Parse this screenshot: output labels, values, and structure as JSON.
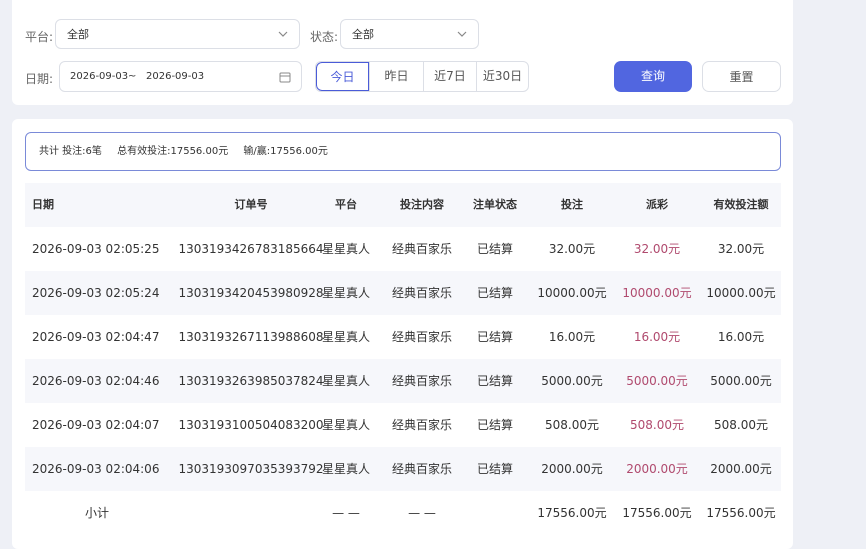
{
  "filters": {
    "platform_label": "平台:",
    "platform_value": "全部",
    "status_label": "状态:",
    "status_value": "全部",
    "date_label": "日期:",
    "date_start": "2026-09-03",
    "date_sep": "~",
    "date_end": "2026-09-03",
    "quick_ranges": [
      "今日",
      "昨日",
      "近7日",
      "近30日"
    ],
    "active_range": "今日",
    "query_label": "查询",
    "reset_label": "重置"
  },
  "summary": {
    "total": "共计 投注:6笔",
    "valid": "总有效投注:17556.00元",
    "winloss": "输/赢:17556.00元"
  },
  "table": {
    "columns": [
      "日期",
      "订单号",
      "平台",
      "投注内容",
      "注单状态",
      "投注",
      "派彩",
      "有效投注额"
    ],
    "rows": [
      [
        "2026-09-03 02:05:25",
        "1303193426783185664",
        "星星真人",
        "经典百家乐",
        "已结算",
        "32.00元",
        "32.00元",
        "32.00元"
      ],
      [
        "2026-09-03 02:05:24",
        "1303193420453980928",
        "星星真人",
        "经典百家乐",
        "已结算",
        "10000.00元",
        "10000.00元",
        "10000.00元"
      ],
      [
        "2026-09-03 02:04:47",
        "1303193267113988608",
        "星星真人",
        "经典百家乐",
        "已结算",
        "16.00元",
        "16.00元",
        "16.00元"
      ],
      [
        "2026-09-03 02:04:46",
        "1303193263985037824",
        "星星真人",
        "经典百家乐",
        "已结算",
        "5000.00元",
        "5000.00元",
        "5000.00元"
      ],
      [
        "2026-09-03 02:04:07",
        "1303193100504083200",
        "星星真人",
        "经典百家乐",
        "已结算",
        "508.00元",
        "508.00元",
        "508.00元"
      ],
      [
        "2026-09-03 02:04:06",
        "1303193097035393792",
        "星星真人",
        "经典百家乐",
        "已结算",
        "2000.00元",
        "2000.00元",
        "2000.00元"
      ]
    ],
    "subtotal": {
      "label": "小计",
      "platform": "— —",
      "content": "— —",
      "bet": "17556.00元",
      "payout": "17556.00元",
      "valid": "17556.00元"
    }
  },
  "colors": {
    "accent": "#5166e0",
    "payout_text": "#b04a6e"
  },
  "icons": [
    "chevron-down-icon",
    "calendar-icon"
  ]
}
